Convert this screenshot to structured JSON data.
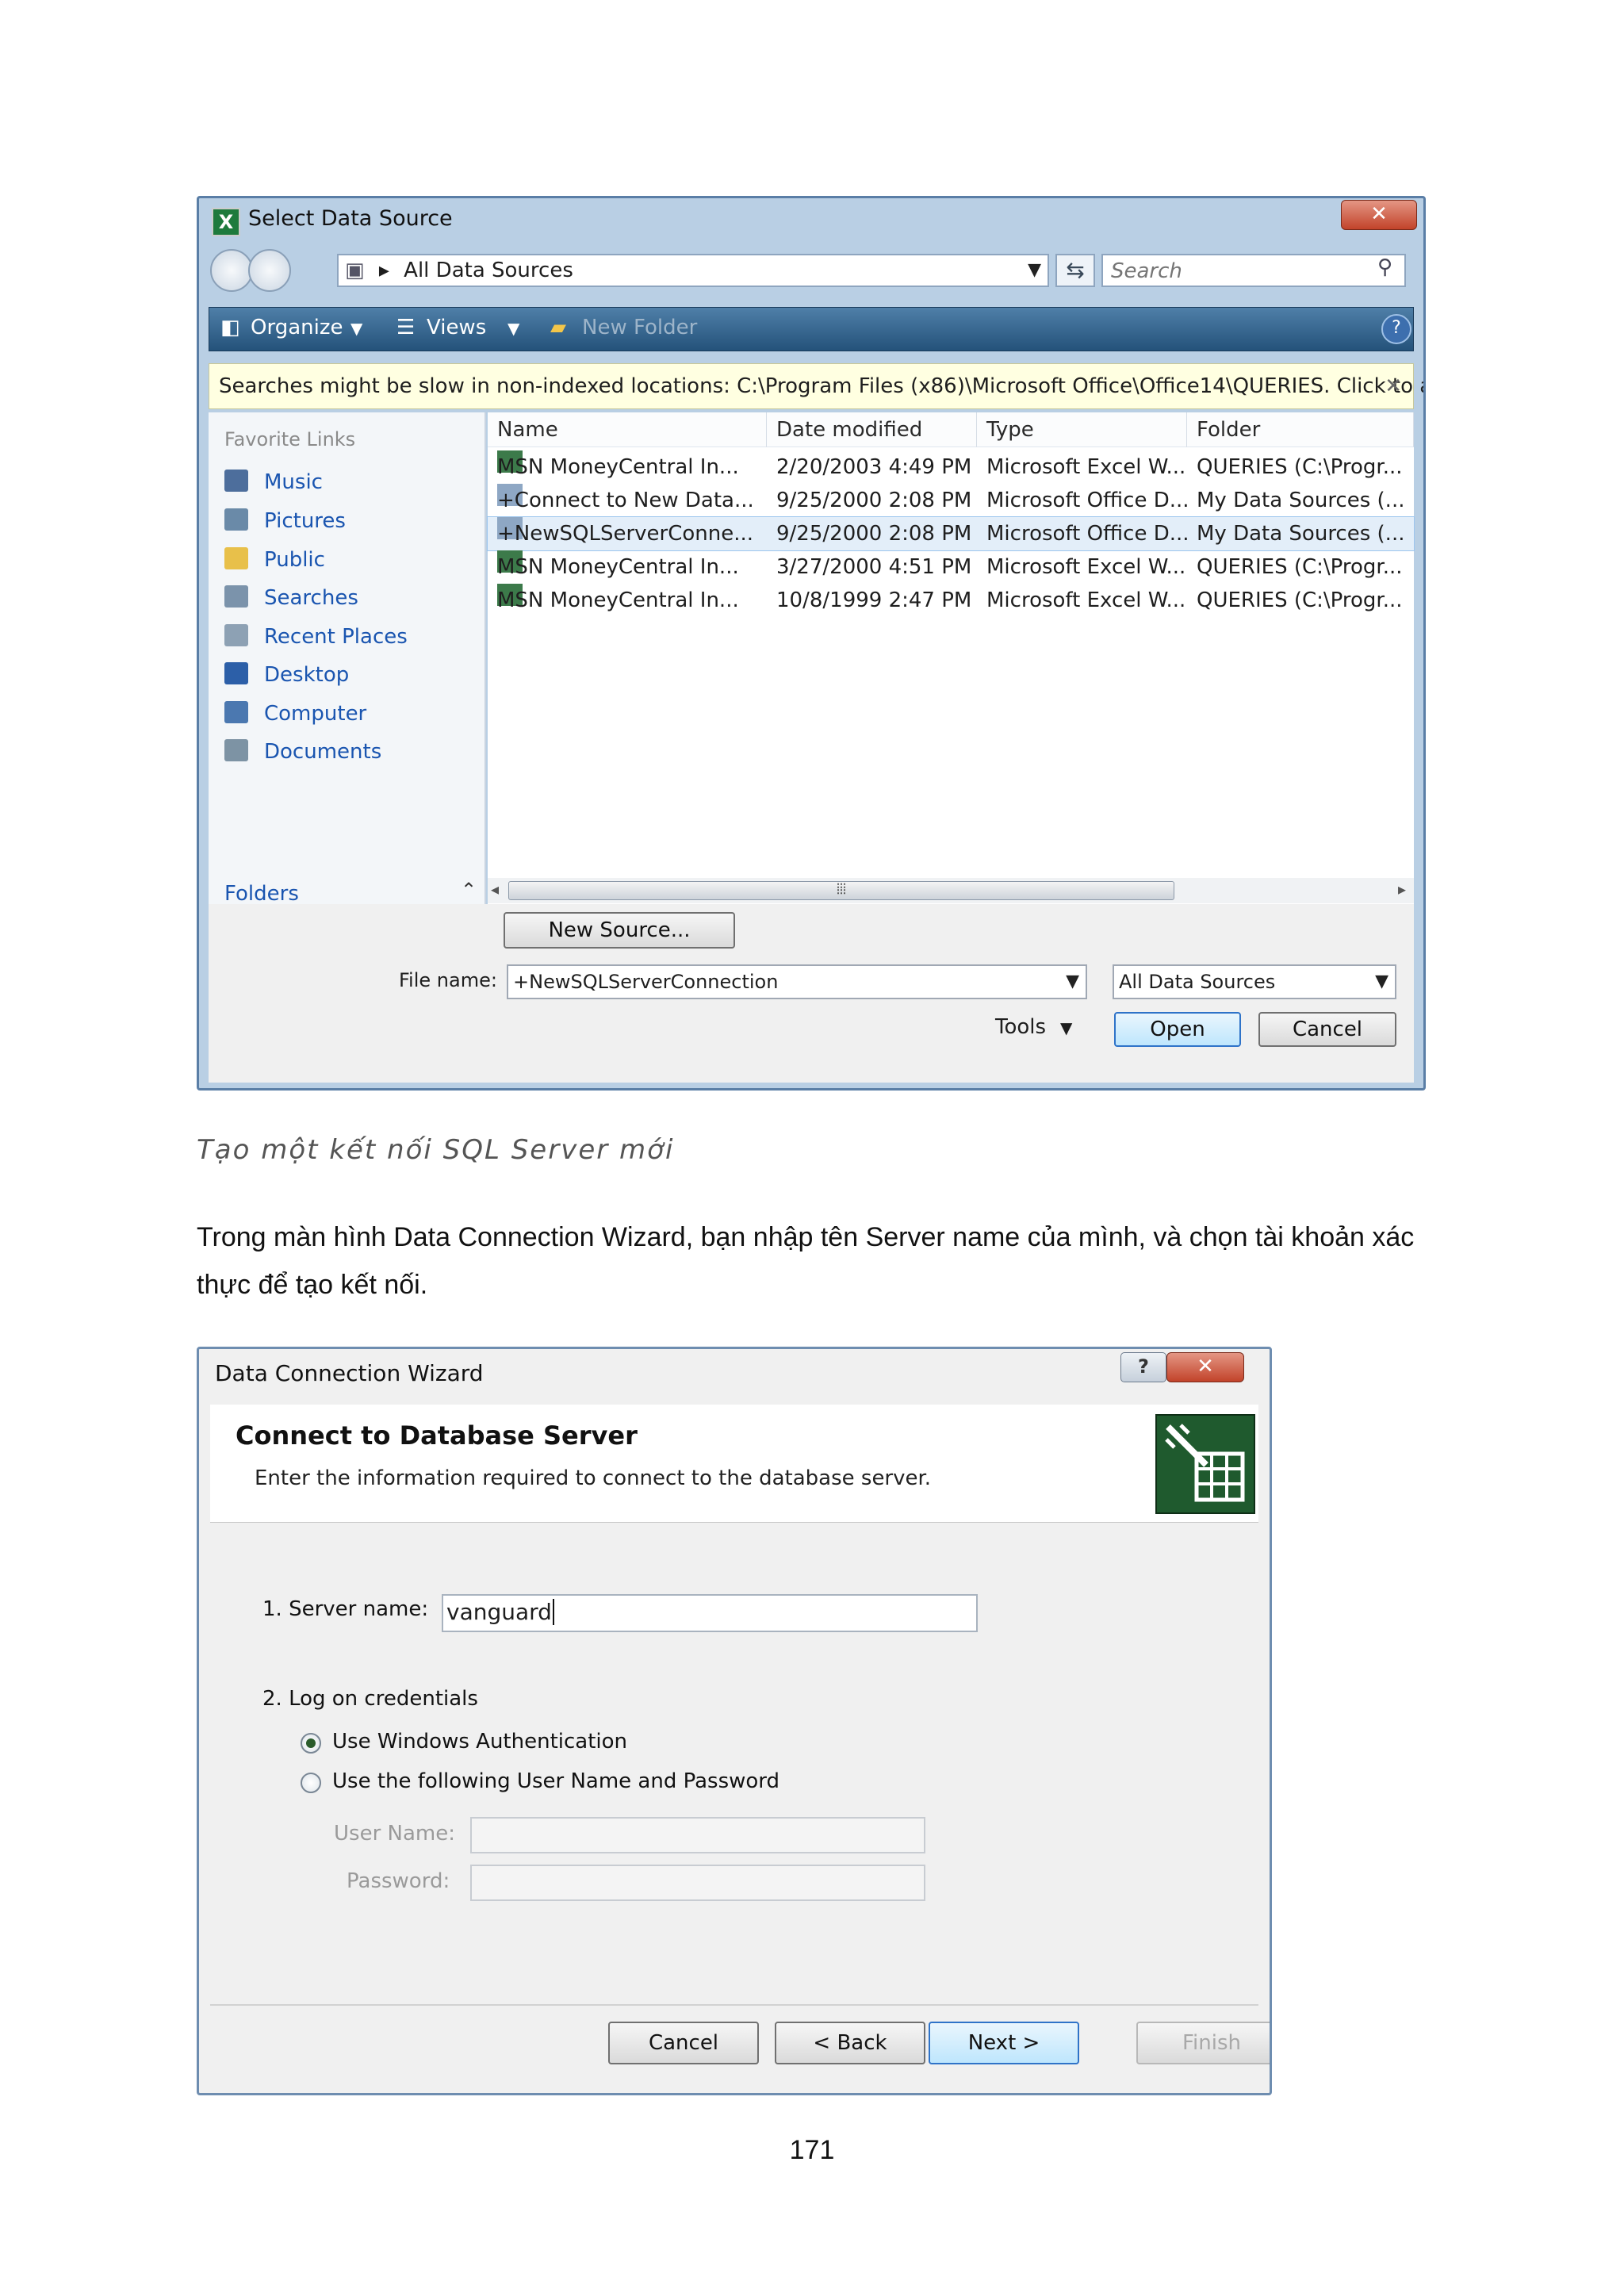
{
  "select_data_source": {
    "title": "Select Data Source",
    "address": "All Data Sources",
    "search_placeholder": "Search",
    "toolbar": {
      "organize": "Organize",
      "views": "Views",
      "new_folder": "New Folder"
    },
    "info_bar": "Searches might be slow in non-indexed locations: C:\\Program Files (x86)\\Microsoft Office\\Office14\\QUERIES. Click to add...",
    "favorite_links_header": "Favorite Links",
    "favorite_links": [
      "Music",
      "Pictures",
      "Public",
      "Searches",
      "Recent Places",
      "Desktop",
      "Computer",
      "Documents"
    ],
    "folders_label": "Folders",
    "columns": [
      "Name",
      "Date modified",
      "Type",
      "Folder"
    ],
    "files": [
      {
        "name": "MSN MoneyCentral In...",
        "date": "2/20/2003 4:49 PM",
        "type": "Microsoft Excel W...",
        "folder": "QUERIES (C:\\Progr..."
      },
      {
        "name": "+Connect to New Data...",
        "date": "9/25/2000 2:08 PM",
        "type": "Microsoft Office D...",
        "folder": "My Data Sources (..."
      },
      {
        "name": "+NewSQLServerConne...",
        "date": "9/25/2000 2:08 PM",
        "type": "Microsoft Office D...",
        "folder": "My Data Sources (..."
      },
      {
        "name": "MSN MoneyCentral In...",
        "date": "3/27/2000 4:51 PM",
        "type": "Microsoft Excel W...",
        "folder": "QUERIES (C:\\Progr..."
      },
      {
        "name": "MSN MoneyCentral In...",
        "date": "10/8/1999 2:47 PM",
        "type": "Microsoft Excel W...",
        "folder": "QUERIES (C:\\Progr..."
      }
    ],
    "selected_index": 2,
    "new_source_button": "New Source...",
    "file_name_label": "File name:",
    "file_name_value": "+NewSQLServerConnection",
    "file_type_value": "All Data Sources",
    "tools_label": "Tools",
    "open_button": "Open",
    "cancel_button": "Cancel"
  },
  "caption": "Tạo một kết nối SQL Server mới",
  "paragraph": "Trong màn hình Data Connection Wizard, bạn nhập tên Server name của mình, và chọn tài khoản xác thực để tạo kết nối.",
  "data_connection_wizard": {
    "title": "Data Connection Wizard",
    "heading": "Connect to Database Server",
    "subheading": "Enter the information required to connect to the database server.",
    "server_name_label": "1. Server name:",
    "server_name_value": "vanguard",
    "logon_label": "2. Log on credentials",
    "radio_windows": "Use Windows Authentication",
    "radio_user": "Use the following User Name and Password",
    "windows_selected": true,
    "user_name_label": "User Name:",
    "password_label": "Password:",
    "cancel_button": "Cancel",
    "back_button": "< Back",
    "next_button": "Next >",
    "finish_button": "Finish"
  },
  "page_number": "171",
  "colors": {
    "link_blue": "#1a55b0",
    "toolbar_blue": "#24527a",
    "info_yellow": "#ffffe1",
    "close_red": "#c2432a"
  }
}
